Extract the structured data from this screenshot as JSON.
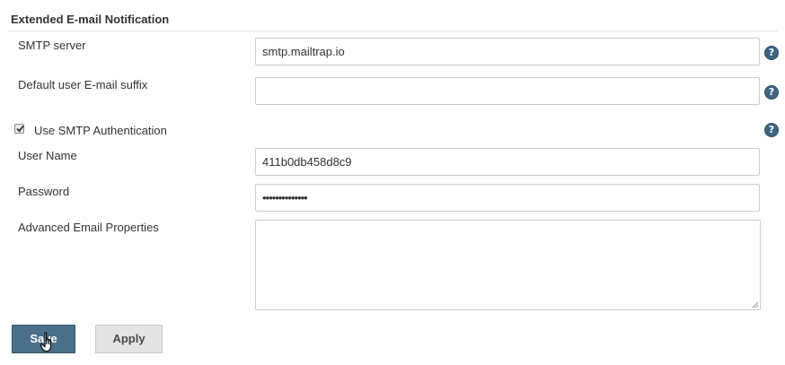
{
  "section": {
    "title": "Extended E-mail Notification"
  },
  "fields": {
    "smtp_server": {
      "label": "SMTP server",
      "value": "smtp.mailtrap.io"
    },
    "email_suffix": {
      "label": "Default user E-mail suffix",
      "value": ""
    },
    "use_smtp_auth": {
      "label": "Use SMTP Authentication",
      "checked": true
    },
    "user_name": {
      "label": "User Name",
      "value": "411b0db458d8c9"
    },
    "password": {
      "label": "Password",
      "value": "••••••••••••••"
    },
    "advanced_props": {
      "label": "Advanced Email Properties",
      "value": ""
    }
  },
  "buttons": {
    "save": "Save",
    "apply": "Apply"
  },
  "icons": {
    "help": "help-icon",
    "checkbox": "checkbox-checked-icon",
    "cursor": "hand-pointer-cursor"
  },
  "colors": {
    "help_icon": "#3d6580",
    "save_button": "#4a6f88",
    "apply_button": "#e4e4e4"
  }
}
